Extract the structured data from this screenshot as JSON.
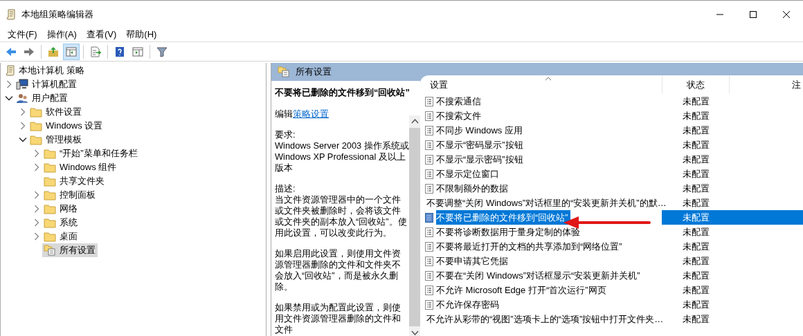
{
  "window": {
    "title": "本地组策略编辑器"
  },
  "menu": [
    "文件(F)",
    "操作(A)",
    "查看(V)",
    "帮助(H)"
  ],
  "tree": {
    "label": "本地计算机 策略",
    "kind": "policy",
    "selected": false,
    "children": [
      {
        "label": "计算机配置",
        "kind": "computer",
        "selected": false,
        "expanded": false
      },
      {
        "label": "用户配置",
        "kind": "users",
        "selected": false,
        "expanded": true,
        "children": [
          {
            "label": "软件设置",
            "kind": "folder",
            "selected": false,
            "expanded": false
          },
          {
            "label": "Windows 设置",
            "kind": "folder",
            "selected": false,
            "expanded": false
          },
          {
            "label": "管理模板",
            "kind": "folder",
            "selected": false,
            "expanded": true,
            "children": [
              {
                "label": "“开始”菜单和任务栏",
                "kind": "folder",
                "selected": false,
                "expanded": false
              },
              {
                "label": "Windows 组件",
                "kind": "folder",
                "selected": false,
                "expanded": false
              },
              {
                "label": "共享文件夹",
                "kind": "leaf-folder",
                "selected": false
              },
              {
                "label": "控制面板",
                "kind": "folder",
                "selected": false,
                "expanded": false
              },
              {
                "label": "网络",
                "kind": "folder",
                "selected": false,
                "expanded": false
              },
              {
                "label": "系统",
                "kind": "folder",
                "selected": false,
                "expanded": false
              },
              {
                "label": "桌面",
                "kind": "folder",
                "selected": false,
                "expanded": false
              },
              {
                "label": "所有设置",
                "kind": "settings",
                "selected": true
              }
            ]
          }
        ]
      }
    ]
  },
  "panel_title": "所有设置",
  "description": {
    "heading": "不要将已删除的文件移到“回收站”",
    "edit_prefix": "编辑",
    "edit_link": "策略设置",
    "requirements_label": "要求:",
    "requirements": "Windows Server 2003 操作系统或 Windows XP Professional 及以上版本",
    "description_label": "描述:",
    "paragraphs": [
      "当文件资源管理器中的一个文件或文件夹被删除时，会将该文件或文件夹的副本放入“回收站”。使用此设置，可以改变此行为。",
      "如果启用此设置，则使用文件资源管理器删除的文件和文件夹不会放入“回收站”，而是被永久删除。",
      "如果禁用或为配置此设置，则使用文件资源管理器删除的文件和文件"
    ]
  },
  "table": {
    "columns": [
      "设置",
      "状态",
      "注"
    ],
    "rows": [
      {
        "name": "不搜索通信",
        "state": "未配置",
        "selected": false
      },
      {
        "name": "不搜索文件",
        "state": "未配置",
        "selected": false
      },
      {
        "name": "不同步 Windows 应用",
        "state": "未配置",
        "selected": false
      },
      {
        "name": "不显示“密码显示”按钮",
        "state": "未配置",
        "selected": false
      },
      {
        "name": "不显示“显示密码”按钮",
        "state": "未配置",
        "selected": false
      },
      {
        "name": "不显示定位窗口",
        "state": "未配置",
        "selected": false
      },
      {
        "name": "不限制额外的数据",
        "state": "未配置",
        "selected": false
      },
      {
        "name": "不要调整“关闭 Windows”对话框里的“安装更新并关机”的默…",
        "state": "未配置",
        "selected": false
      },
      {
        "name": "不要将已删除的文件移到“回收站”",
        "state": "未配置",
        "selected": true
      },
      {
        "name": "不要将诊断数据用于量身定制的体验",
        "state": "未配置",
        "selected": false
      },
      {
        "name": "不要将最近打开的文档的共享添加到“网络位置”",
        "state": "未配置",
        "selected": false
      },
      {
        "name": "不要申请其它凭据",
        "state": "未配置",
        "selected": false
      },
      {
        "name": "不要在“关闭 Windows”对话框显示“安装更新并关机”",
        "state": "未配置",
        "selected": false
      },
      {
        "name": "不允许 Microsoft Edge 打开“首次运行”网页",
        "state": "未配置",
        "selected": false
      },
      {
        "name": "不允许保存密码",
        "state": "未配置",
        "selected": false
      },
      {
        "name": "不允许从彩带的“视图”选项卡上的“选项”按钮中打开文件夹…",
        "state": "未配置",
        "selected": false
      }
    ]
  }
}
